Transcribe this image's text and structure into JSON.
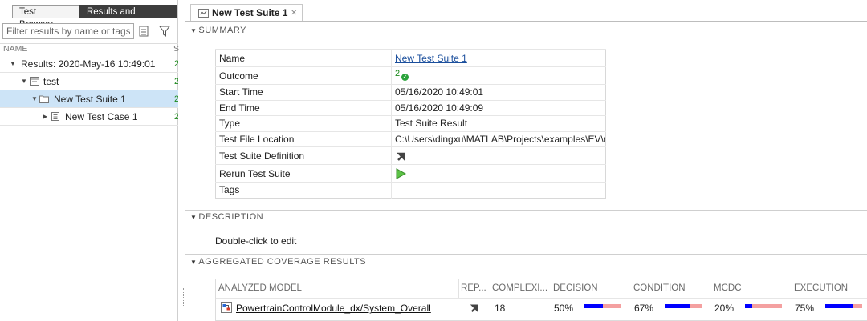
{
  "left_panel": {
    "tabs": [
      "Test Browser",
      "Results and Artifacts"
    ],
    "filter_placeholder": "Filter results by name or tags",
    "column_header": "NAME",
    "column_header_2": "S",
    "tree": [
      {
        "label": "Results: 2020-May-16 10:49:01",
        "count": "2"
      },
      {
        "label": "test",
        "count": "2"
      },
      {
        "label": "New Test Suite 1",
        "count": "2"
      },
      {
        "label": "New Test Case 1",
        "count": "2"
      }
    ]
  },
  "doc_tab": {
    "title": "New Test Suite 1",
    "close": "✕"
  },
  "summary": {
    "header": "SUMMARY",
    "rows": [
      {
        "key": "Name",
        "value": "New Test Suite 1"
      },
      {
        "key": "Outcome",
        "value": "2"
      },
      {
        "key": "Start Time",
        "value": "05/16/2020 10:49:01"
      },
      {
        "key": "End Time",
        "value": "05/16/2020 10:49:09"
      },
      {
        "key": "Type",
        "value": "Test Suite Result"
      },
      {
        "key": "Test File Location",
        "value": "C:\\Users\\dingxu\\MATLAB\\Projects\\examples\\EV\\ma..."
      },
      {
        "key": "Test Suite Definition",
        "value": ""
      },
      {
        "key": "Rerun Test Suite",
        "value": ""
      },
      {
        "key": "Tags",
        "value": ""
      }
    ]
  },
  "description": {
    "header": "DESCRIPTION",
    "text": "Double-click to edit"
  },
  "coverage": {
    "header": "AGGREGATED COVERAGE RESULTS",
    "columns": [
      "ANALYZED MODEL",
      "REP...",
      "COMPLEXI...",
      "DECISION",
      "CONDITION",
      "MCDC",
      "EXECUTION"
    ],
    "row": {
      "model": "PowertrainControlModule_dx/System_Overall",
      "complexity": "18",
      "decision": "50%",
      "condition": "67%",
      "mcdc": "20%",
      "execution": "75%"
    },
    "fractions": {
      "decision": 0.5,
      "condition": 0.67,
      "mcdc": 0.2,
      "execution": 0.75
    },
    "colors": {
      "covered": "#0000ff",
      "missed": "#f4a0a0"
    }
  }
}
